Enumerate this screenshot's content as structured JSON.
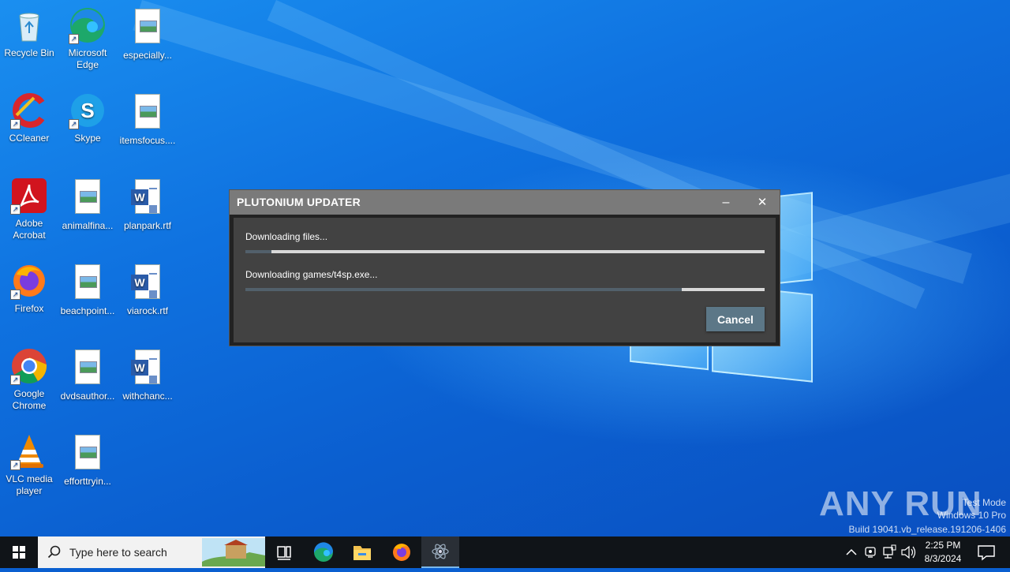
{
  "desktop": {
    "icons": [
      {
        "label": "Recycle Bin",
        "icon": "recycle-bin-icon"
      },
      {
        "label": "Microsoft Edge",
        "icon": "edge-icon"
      },
      {
        "label": "especially...",
        "icon": "image-file-icon"
      },
      {
        "label": "CCleaner",
        "icon": "ccleaner-icon"
      },
      {
        "label": "Skype",
        "icon": "skype-icon"
      },
      {
        "label": "itemsfocus....",
        "icon": "image-file-icon"
      },
      {
        "label": "Adobe Acrobat",
        "icon": "acrobat-icon"
      },
      {
        "label": "animalfina...",
        "icon": "image-file-icon"
      },
      {
        "label": "planpark.rtf",
        "icon": "word-doc-icon"
      },
      {
        "label": "Firefox",
        "icon": "firefox-icon"
      },
      {
        "label": "beachpoint...",
        "icon": "image-file-icon"
      },
      {
        "label": "viarock.rtf",
        "icon": "word-doc-icon"
      },
      {
        "label": "Google Chrome",
        "icon": "chrome-icon"
      },
      {
        "label": "dvdsauthor...",
        "icon": "image-file-icon"
      },
      {
        "label": "withchanc...",
        "icon": "word-doc-icon"
      },
      {
        "label": "VLC media player",
        "icon": "vlc-icon"
      },
      {
        "label": "efforttryin...",
        "icon": "image-file-icon"
      }
    ]
  },
  "dialog": {
    "title": "PLUTONIUM UPDATER",
    "status1": "Downloading files...",
    "progress1": 0.05,
    "status2": "Downloading games/t4sp.exe...",
    "progress2": 0.84,
    "cancel_label": "Cancel",
    "minimize_glyph": "–",
    "close_glyph": "✕"
  },
  "watermark": {
    "brand": "ANY RUN",
    "line1": "Test Mode",
    "line2": "Windows 10 Pro",
    "line3": "Build 19041.vb_release.191206-1406"
  },
  "taskbar": {
    "search_placeholder": "Type here to search",
    "apps": [
      "task-view-icon",
      "edge-icon",
      "file-explorer-icon",
      "firefox-icon",
      "plutonium-icon"
    ],
    "time": "2:25 PM",
    "date": "8/3/2024"
  },
  "colors": {
    "dialog_titlebar": "#7a7a7a",
    "dialog_panel": "#424242",
    "progress_track": "#d8d8d8",
    "progress_fill": "#52606b",
    "cancel_button": "#5c7787",
    "taskbar": "#101418"
  }
}
